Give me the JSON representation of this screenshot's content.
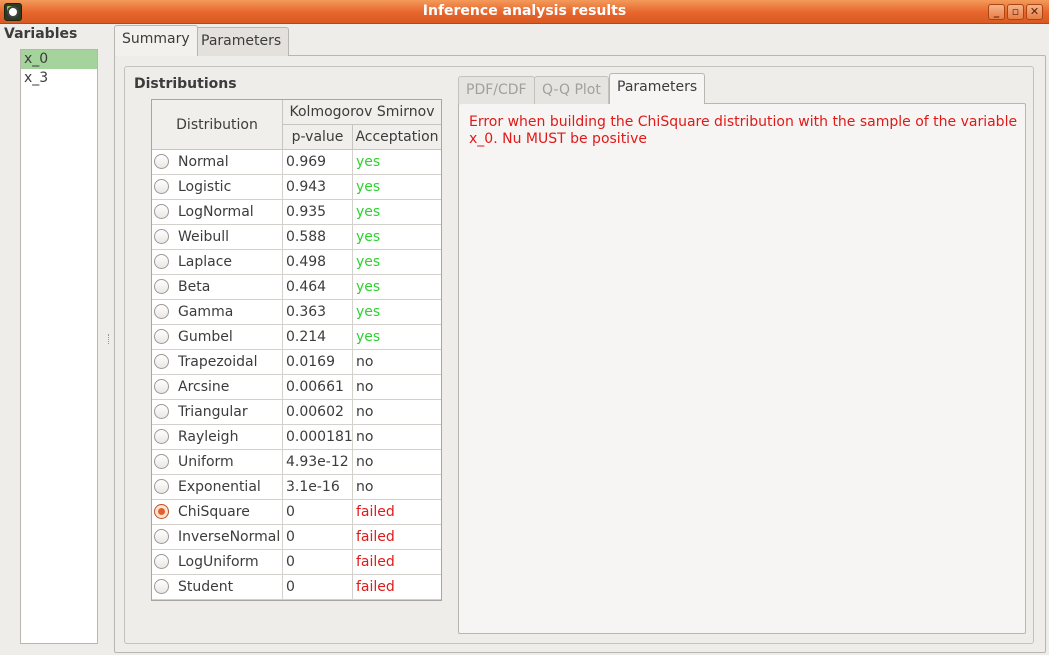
{
  "window": {
    "title": "Inference analysis results",
    "buttons": {
      "minimize": "_",
      "restore": "▫",
      "close": "✕"
    }
  },
  "variables": {
    "label": "Variables",
    "items": [
      {
        "name": "x_0",
        "selected": true
      },
      {
        "name": "x_3",
        "selected": false
      }
    ]
  },
  "tabs": [
    {
      "label": "Summary",
      "active": true
    },
    {
      "label": "Parameters",
      "active": false
    }
  ],
  "distributions": {
    "title": "Distributions",
    "headers": {
      "distribution": "Distribution",
      "test": "Kolmogorov Smirnov",
      "pvalue": "p-value",
      "acceptation": "Acceptation"
    },
    "rows": [
      {
        "name": "Normal",
        "pvalue": "0.969",
        "status": "yes",
        "selected": false
      },
      {
        "name": "Logistic",
        "pvalue": "0.943",
        "status": "yes",
        "selected": false
      },
      {
        "name": "LogNormal",
        "pvalue": "0.935",
        "status": "yes",
        "selected": false
      },
      {
        "name": "Weibull",
        "pvalue": "0.588",
        "status": "yes",
        "selected": false
      },
      {
        "name": "Laplace",
        "pvalue": "0.498",
        "status": "yes",
        "selected": false
      },
      {
        "name": "Beta",
        "pvalue": "0.464",
        "status": "yes",
        "selected": false
      },
      {
        "name": "Gamma",
        "pvalue": "0.363",
        "status": "yes",
        "selected": false
      },
      {
        "name": "Gumbel",
        "pvalue": "0.214",
        "status": "yes",
        "selected": false
      },
      {
        "name": "Trapezoidal",
        "pvalue": "0.0169",
        "status": "no",
        "selected": false
      },
      {
        "name": "Arcsine",
        "pvalue": "0.00661",
        "status": "no",
        "selected": false
      },
      {
        "name": "Triangular",
        "pvalue": "0.00602",
        "status": "no",
        "selected": false
      },
      {
        "name": "Rayleigh",
        "pvalue": "0.000181",
        "status": "no",
        "selected": false
      },
      {
        "name": "Uniform",
        "pvalue": "4.93e-12",
        "status": "no",
        "selected": false
      },
      {
        "name": "Exponential",
        "pvalue": "3.1e-16",
        "status": "no",
        "selected": false
      },
      {
        "name": "ChiSquare",
        "pvalue": "0",
        "status": "failed",
        "selected": true
      },
      {
        "name": "InverseNormal",
        "pvalue": "0",
        "status": "failed",
        "selected": false
      },
      {
        "name": "LogUniform",
        "pvalue": "0",
        "status": "failed",
        "selected": false
      },
      {
        "name": "Student",
        "pvalue": "0",
        "status": "failed",
        "selected": false
      }
    ]
  },
  "inner_tabs": [
    {
      "label": "PDF/CDF",
      "active": false
    },
    {
      "label": "Q-Q Plot",
      "active": false
    },
    {
      "label": "Parameters",
      "active": true
    }
  ],
  "error_message": "Error when building the ChiSquare distribution with the sample of the variable x_0. Nu MUST be positive",
  "colors": {
    "titlebar": "#e7652c",
    "selected_row": "#a4d49b",
    "accept_yes": "#2fd12f",
    "accept_failed": "#e01919"
  }
}
